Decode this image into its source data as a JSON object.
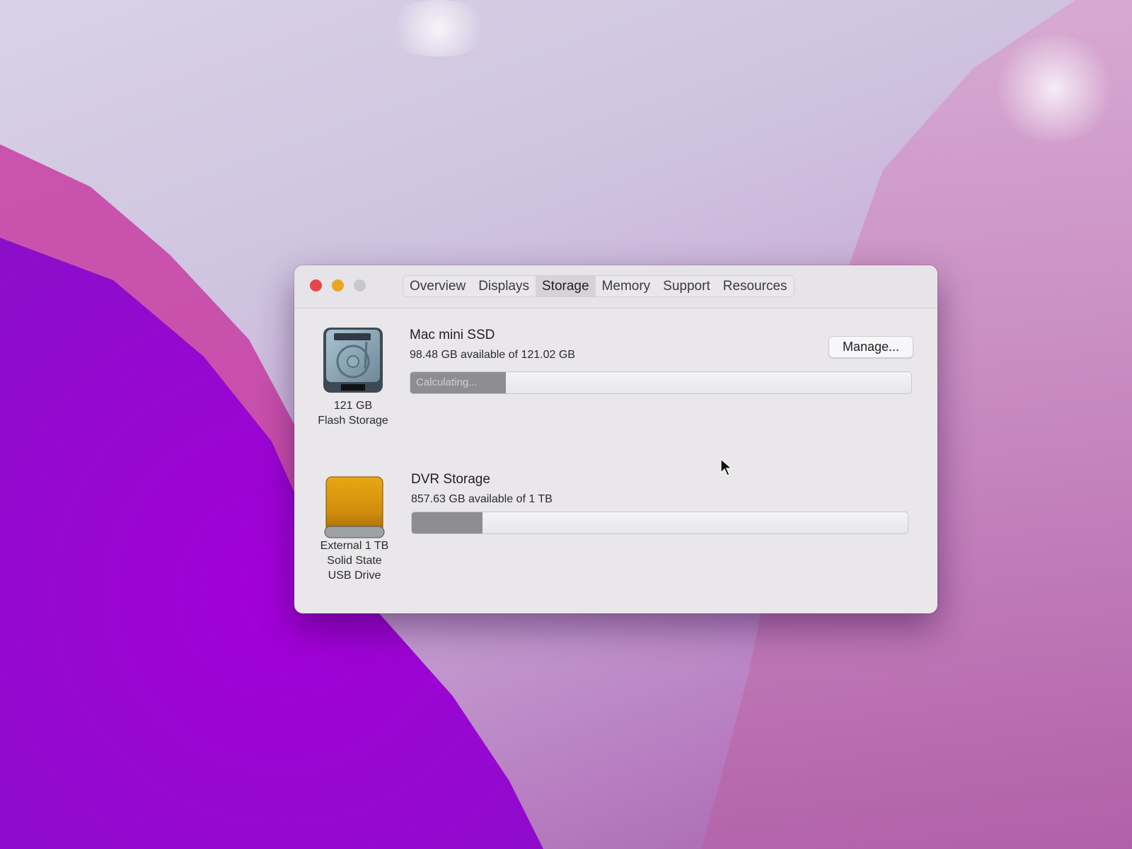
{
  "window": {
    "tabs": [
      {
        "label": "Overview"
      },
      {
        "label": "Displays"
      },
      {
        "label": "Storage"
      },
      {
        "label": "Memory"
      },
      {
        "label": "Support"
      },
      {
        "label": "Resources"
      }
    ],
    "active_tab": "Storage",
    "colors": {
      "close": "#e5474c",
      "minimize": "#e7a721",
      "zoom": "#c8c8ca"
    }
  },
  "drives": [
    {
      "name": "Mac mini SSD",
      "availability": "98.48 GB available of 121.02 GB",
      "bar_label": "Calculating...",
      "used_fraction": 0.19,
      "caption_lines": [
        "121 GB",
        "Flash Storage"
      ],
      "icon": "internal-disk-icon",
      "button": "Manage..."
    },
    {
      "name": "DVR Storage",
      "availability": "857.63 GB available of 1 TB",
      "used_fraction": 0.142,
      "caption_lines": [
        "External 1 TB",
        "Solid State",
        "USB Drive"
      ],
      "icon": "external-drive-icon"
    }
  ]
}
